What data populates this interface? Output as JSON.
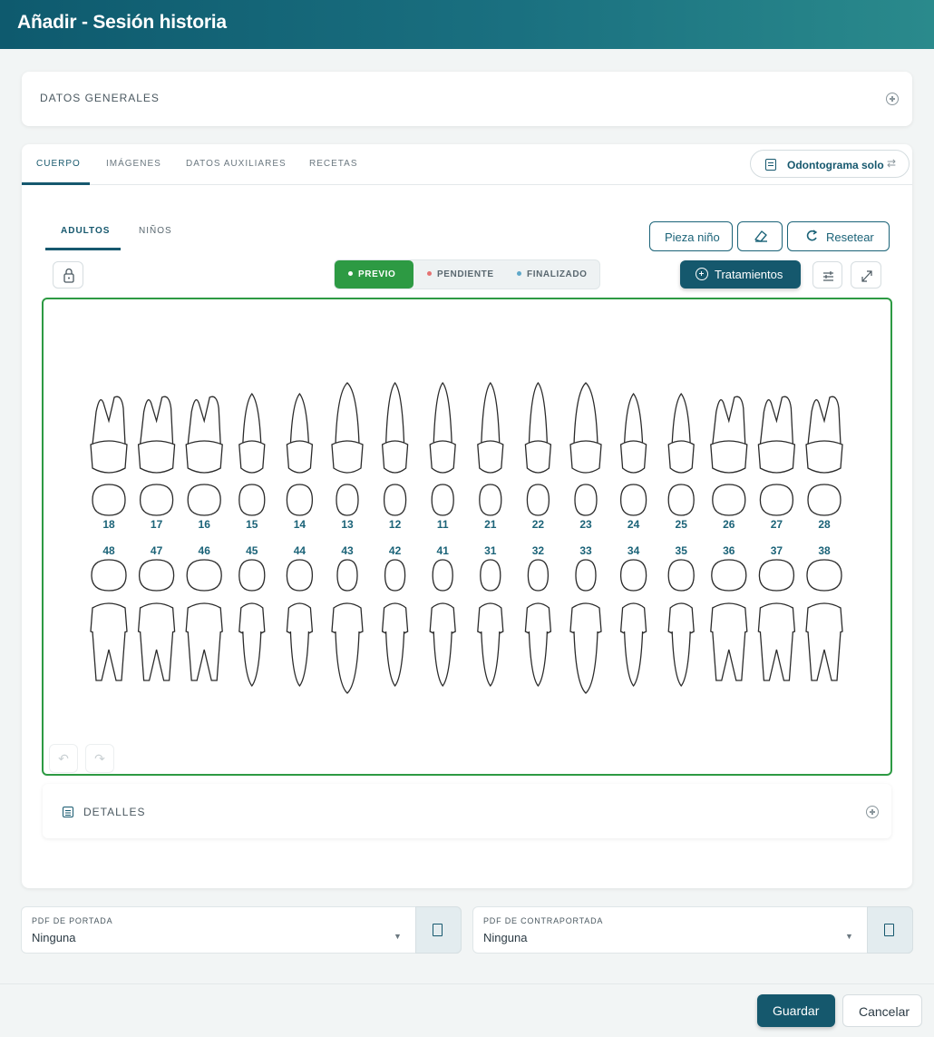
{
  "header": {
    "title": "Añadir - Sesión historia"
  },
  "datos_generales": {
    "label": "DATOS GENERALES"
  },
  "tabs": [
    {
      "label": "CUERPO",
      "active": true
    },
    {
      "label": "IMÁGENES",
      "active": false
    },
    {
      "label": "DATOS AUXILIARES",
      "active": false
    },
    {
      "label": "RECETAS",
      "active": false
    }
  ],
  "odontograma_btn": {
    "label": "Odontograma solo"
  },
  "subtabs": [
    {
      "label": "ADULTOS",
      "active": true
    },
    {
      "label": "NIÑOS",
      "active": false
    }
  ],
  "actions": {
    "pieza_nino": "Pieza niño",
    "resetear": "Resetear",
    "tratamientos": "Tratamientos"
  },
  "status_toggle": [
    {
      "label": "PREVIO",
      "color": "#ffffff",
      "active": true
    },
    {
      "label": "PENDIENTE",
      "color": "#e57373",
      "active": false
    },
    {
      "label": "FINALIZADO",
      "color": "#5fa8c9",
      "active": false
    }
  ],
  "odontogram": {
    "upper_teeth": [
      "18",
      "17",
      "16",
      "15",
      "14",
      "13",
      "12",
      "11",
      "21",
      "22",
      "23",
      "24",
      "25",
      "26",
      "27",
      "28"
    ],
    "lower_teeth": [
      "48",
      "47",
      "46",
      "45",
      "44",
      "43",
      "42",
      "41",
      "31",
      "32",
      "33",
      "34",
      "35",
      "36",
      "37",
      "38"
    ]
  },
  "detalles": {
    "label": "DETALLES"
  },
  "pdf_portada": {
    "label": "PDF DE PORTADA",
    "value": "Ninguna"
  },
  "pdf_contraportada": {
    "label": "PDF DE CONTRAPORTADA",
    "value": "Ninguna"
  },
  "footer": {
    "guardar": "Guardar",
    "cancelar": "Cancelar"
  },
  "colors": {
    "brand": "#15586d",
    "accent_green": "#2d9a43",
    "tooth_number": "#1b6378"
  }
}
